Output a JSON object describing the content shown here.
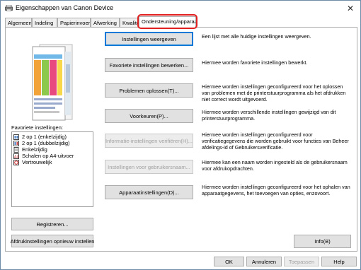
{
  "window": {
    "title": "Eigenschappen van Canon Device"
  },
  "tabs": [
    {
      "label": "Algemeen"
    },
    {
      "label": "Indeling"
    },
    {
      "label": "Papierinvoer"
    },
    {
      "label": "Afwerking"
    },
    {
      "label": "Kwaliteit"
    },
    {
      "label": "Ondersteuning/apparaat"
    }
  ],
  "favorites": {
    "label": "Favoriete instellingen:",
    "items": [
      {
        "label": "2 op 1 (enkelzijdig)",
        "icon": "two-on-one-icon"
      },
      {
        "label": "2 op 1 (dubbelzijdig)",
        "icon": "two-on-one-duplex-icon"
      },
      {
        "label": "Enkelzijdig",
        "icon": "single-sided-icon"
      },
      {
        "label": "Schalen op A4-uitvoer",
        "icon": "scale-a4-icon"
      },
      {
        "label": "Vertrouwelijk",
        "icon": "confidential-icon"
      }
    ],
    "register_button": "Registreren...",
    "reset_button": "Afdrukinstellingen opnieuw instellen"
  },
  "actions": [
    {
      "label": "Instellingen weergeven",
      "desc": "Een lijst met alle huidige instellingen weergeven.",
      "enabled": true
    },
    {
      "label": "Favoriete instellingen bewerken...",
      "desc": "Hiermee worden favoriete instellingen bewerkt.",
      "enabled": true
    },
    {
      "label": "Problemen oplossen(T)...",
      "desc": "Hiermee worden instellingen geconfigureerd voor het oplossen van problemen met de printerstuurprogramma als het afdrukken niet correct wordt uitgevoerd.",
      "enabled": true
    },
    {
      "label": "Voorkeuren(P)...",
      "desc": "Hiermee worden verschillende instellingen gewijzigd van dit printerstuurprogramma.",
      "enabled": true
    },
    {
      "label": "Informatie-instellingen verifiëren(H)...",
      "desc": "Hiermee worden instellingen geconfigureerd voor verificatiegegevens die worden gebruikt voor functies van Beheer afdelings-id of Gebruikersverificatie.",
      "enabled": false
    },
    {
      "label": "Instellingen voor gebruikersnaam...",
      "desc": "Hiermee kan een naam worden ingesteld als de gebruikersnaam voor afdrukopdrachten.",
      "enabled": false
    },
    {
      "label": "Apparaatinstellingen(D)...",
      "desc": "Hiermee worden instellingen geconfigureerd voor het ophalen van apparaatgegevens, het toevoegen van opties, enzovoort.",
      "enabled": true
    }
  ],
  "info_button": "Info(B)",
  "footer": {
    "ok": "OK",
    "cancel": "Annuleren",
    "apply": "Toepassen",
    "help": "Help"
  }
}
